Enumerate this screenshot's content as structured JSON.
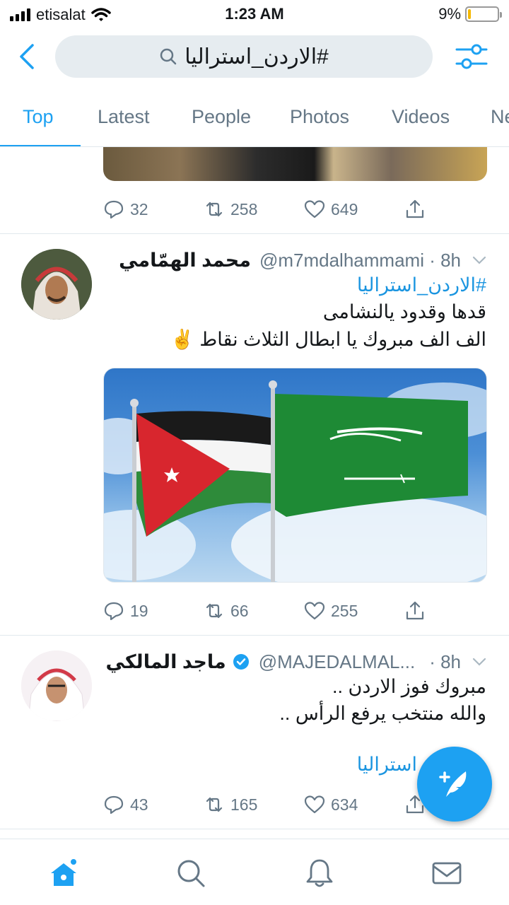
{
  "status_bar": {
    "carrier": "etisalat",
    "time": "1:23 AM",
    "battery": "9%",
    "battery_level": 0.09
  },
  "search": {
    "query": "#الاردن_استراليا"
  },
  "tabs": [
    {
      "label": "Top",
      "active": true
    },
    {
      "label": "Latest"
    },
    {
      "label": "People"
    },
    {
      "label": "Photos"
    },
    {
      "label": "Videos"
    },
    {
      "label": "Ne"
    }
  ],
  "tweets": [
    {
      "replies": "32",
      "retweets": "258",
      "likes": "649"
    },
    {
      "name": "محمد الهمّامي",
      "handle": "@m7mdalhammami · 8h",
      "hashtag": "#الاردن_استراليا",
      "line1": "قدها وقدود يالنشامى",
      "line2": "الف الف مبروك يا ابطال الثلاث نقاط ✌️",
      "replies": "19",
      "retweets": "66",
      "likes": "255"
    },
    {
      "name": "ماجد المالكي",
      "handle": "@MAJEDALMAL...",
      "time": "· 8h",
      "line1": "مبروك فوز الاردن ..",
      "line2": "والله منتخب يرفع الرأس ..",
      "hashtag_partial": "استراليا",
      "replies": "43",
      "retweets": "165",
      "likes": "634"
    }
  ],
  "colors": {
    "accent": "#1da1f2",
    "muted": "#657786",
    "link": "#1b95e0"
  },
  "icons": [
    "back-arrow-icon",
    "search-icon",
    "filter-icon",
    "reply-icon",
    "retweet-icon",
    "like-icon",
    "share-icon",
    "home-icon",
    "explore-icon",
    "notifications-icon",
    "messages-icon",
    "compose-icon",
    "verified-icon"
  ]
}
